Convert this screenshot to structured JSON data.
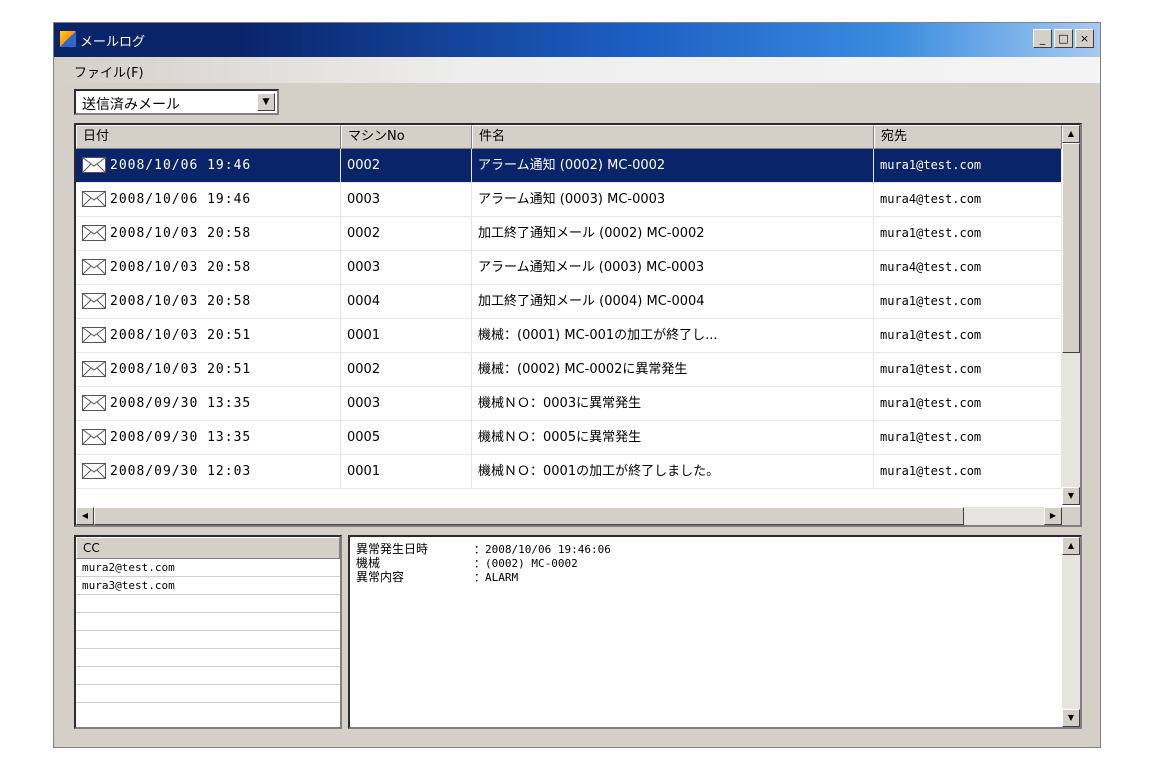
{
  "window": {
    "title": "メールログ",
    "buttons": [
      "_",
      "□",
      "×"
    ]
  },
  "menu": {
    "file": "ファイル(F)"
  },
  "folder_select": {
    "value": "送信済みメール"
  },
  "mail_list": {
    "columns": [
      "日付",
      "マシンNo",
      "件名",
      "宛先"
    ],
    "rows": [
      {
        "date": "2008/10/06 19:46",
        "machine": "0002",
        "subject": "アラーム通知 (0002) MC-0002",
        "to": "mura1@test.com",
        "selected": true
      },
      {
        "date": "2008/10/06 19:46",
        "machine": "0003",
        "subject": "アラーム通知 (0003) MC-0003",
        "to": "mura4@test.com"
      },
      {
        "date": "2008/10/03 20:58",
        "machine": "0002",
        "subject": "加工終了通知メール (0002) MC-0002",
        "to": "mura1@test.com"
      },
      {
        "date": "2008/10/03 20:58",
        "machine": "0003",
        "subject": "アラーム通知メール (0003) MC-0003",
        "to": "mura4@test.com"
      },
      {
        "date": "2008/10/03 20:58",
        "machine": "0004",
        "subject": "加工終了通知メール (0004) MC-0004",
        "to": "mura1@test.com"
      },
      {
        "date": "2008/10/03 20:51",
        "machine": "0001",
        "subject": "機械：(0001) MC-001の加工が終了し...",
        "to": "mura1@test.com"
      },
      {
        "date": "2008/10/03 20:51",
        "machine": "0002",
        "subject": "機械：(0002) MC-0002に異常発生",
        "to": "mura1@test.com"
      },
      {
        "date": "2008/09/30 13:35",
        "machine": "0003",
        "subject": "機械ＮＯ：0003に異常発生",
        "to": "mura1@test.com"
      },
      {
        "date": "2008/09/30 13:35",
        "machine": "0005",
        "subject": "機械ＮＯ：0005に異常発生",
        "to": "mura1@test.com"
      },
      {
        "date": "2008/09/30 12:03",
        "machine": "0001",
        "subject": "機械ＮＯ：0001の加工が終了しました。",
        "to": "mura1@test.com"
      }
    ]
  },
  "cc_pane": {
    "header": "CC",
    "rows": [
      "mura2@test.com",
      "mura3@test.com",
      "",
      "",
      "",
      "",
      "",
      ""
    ]
  },
  "message_body": {
    "lines": [
      {
        "label": "異常発生日時",
        "value": "：2008/10/06 19:46:06"
      },
      {
        "label": "機械",
        "value": "：(0002) MC-0002"
      },
      {
        "label": "異常内容",
        "value": "：ALARM"
      }
    ]
  }
}
